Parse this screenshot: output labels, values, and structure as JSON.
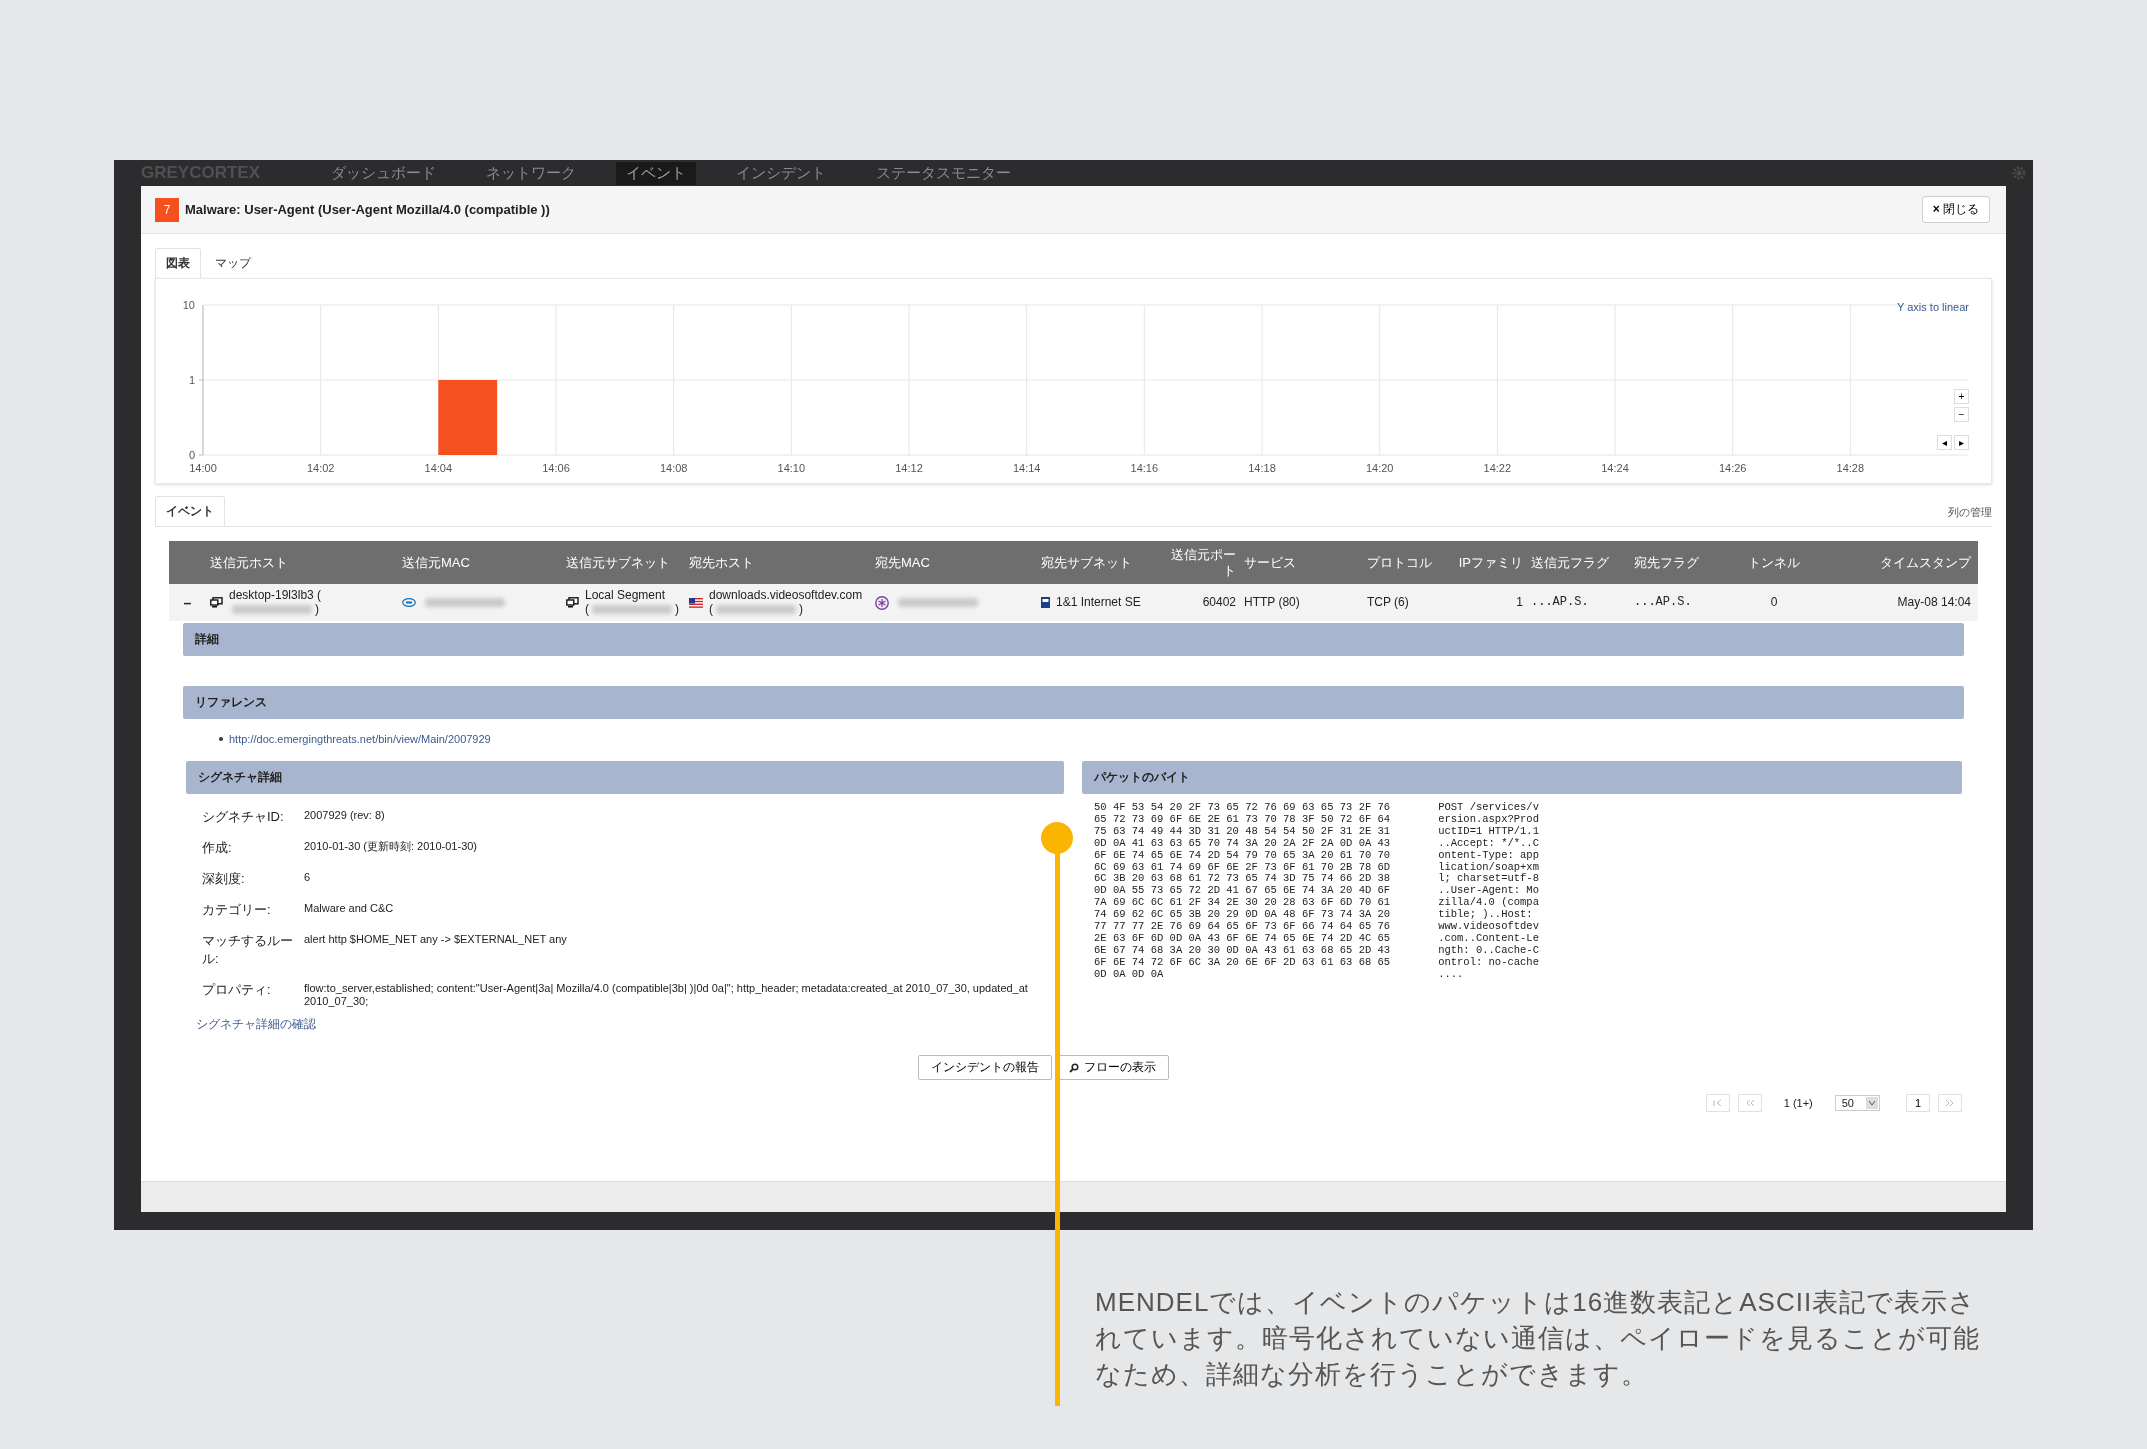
{
  "nav": {
    "brand": "GREYCORTEX",
    "items": [
      {
        "label": "ダッシュボード",
        "selected": false
      },
      {
        "label": "ネットワーク",
        "selected": false
      },
      {
        "label": "イベント",
        "selected": true
      },
      {
        "label": "インシデント",
        "selected": false
      },
      {
        "label": "ステータスモニター",
        "selected": false
      }
    ]
  },
  "modal": {
    "badge": "7",
    "title": "Malware: User-Agent (User-Agent Mozilla/4.0 (compatible ))",
    "close_icon": "×",
    "close": "閉じる"
  },
  "chart_tabs": [
    {
      "label": "図表",
      "selected": true
    },
    {
      "label": "マップ",
      "selected": false
    }
  ],
  "chart": {
    "toggle_link": "Y axis to linear",
    "zoom_in": "+",
    "zoom_out": "−",
    "pan_left": "◂",
    "pan_right": "▸",
    "chart_data": {
      "type": "bar",
      "categories": [
        "14:00",
        "14:02",
        "14:04",
        "14:06",
        "14:08",
        "14:10",
        "14:12",
        "14:14",
        "14:16",
        "14:18",
        "14:20",
        "14:22",
        "14:24",
        "14:26",
        "14:28"
      ],
      "series": [
        {
          "color": "#f4511e",
          "values": [
            0,
            0,
            1,
            0,
            0,
            0,
            0,
            0,
            0,
            0,
            0,
            0,
            0,
            0,
            0
          ]
        }
      ],
      "grid": true,
      "ylim": [
        0,
        2
      ],
      "yticks": [
        0,
        1
      ]
    },
    "y_top_label": "10"
  },
  "events": {
    "tab": {
      "label": "イベント",
      "selected": true
    },
    "manage_columns": "列の管理",
    "columns": [
      "",
      "送信元ホスト",
      "送信元MAC",
      "送信元サブネット",
      "宛先ホスト",
      "宛先MAC",
      "宛先サブネット",
      "送信元ポート",
      "サービス",
      "プロトコル",
      "IPファミリ",
      "送信元フラグ",
      "宛先フラグ",
      "トンネル",
      "タイムスタンプ"
    ],
    "rows": [
      {
        "expanded": true,
        "cells": [
          {
            "kind": "expander",
            "text": "–"
          },
          {
            "kind": "computer",
            "parts": [
              {
                "kind": "text",
                "text": "desktop-19l3lb3 ("
              },
              {
                "kind": "blurred"
              },
              {
                "kind": "text",
                "text": ")"
              }
            ]
          },
          {
            "kind": "nic",
            "parts": [
              {
                "kind": "blurred"
              }
            ]
          },
          {
            "kind": "computer",
            "parts": [
              {
                "kind": "text",
                "text": "Local Segment"
              },
              {
                "kind": "newline"
              },
              {
                "kind": "text",
                "text": "("
              },
              {
                "kind": "blurred"
              },
              {
                "kind": "text",
                "text": ")"
              }
            ]
          },
          {
            "kind": "flag",
            "parts": [
              {
                "kind": "text",
                "text": "downloads.videosoftdev.com"
              },
              {
                "kind": "newline"
              },
              {
                "kind": "text",
                "text": "("
              },
              {
                "kind": "blurred"
              },
              {
                "kind": "text",
                "text": ")"
              }
            ]
          },
          {
            "kind": "vendor",
            "parts": [
              {
                "kind": "blurred"
              }
            ]
          },
          {
            "kind": "network",
            "parts": [
              {
                "kind": "text",
                "text": "1&1 Internet SE"
              }
            ]
          },
          {
            "kind": "plain",
            "parts": [
              {
                "kind": "text",
                "text": "60402"
              }
            ]
          },
          {
            "kind": "plain",
            "parts": [
              {
                "kind": "text",
                "text": "HTTP (80)"
              }
            ]
          },
          {
            "kind": "plain",
            "parts": [
              {
                "kind": "text",
                "text": "TCP (6)"
              }
            ]
          },
          {
            "kind": "plain",
            "parts": [
              {
                "kind": "text",
                "text": "1"
              }
            ]
          },
          {
            "kind": "mono",
            "parts": [
              {
                "kind": "text",
                "text": "...AP.S."
              }
            ]
          },
          {
            "kind": "mono",
            "parts": [
              {
                "kind": "text",
                "text": "...AP.S."
              }
            ]
          },
          {
            "kind": "plain",
            "parts": [
              {
                "kind": "text",
                "text": "0"
              }
            ]
          },
          {
            "kind": "plain",
            "parts": [
              {
                "kind": "text",
                "text": "May-08 14:04"
              }
            ]
          }
        ]
      }
    ]
  },
  "details": {
    "title": "詳細",
    "references_title": "リファレンス",
    "references": [
      "http://doc.emergingthreats.net/bin/view/Main/2007929"
    ],
    "signature": {
      "title": "シグネチャ詳細",
      "rows": [
        {
          "label": "シグネチャID:",
          "value": "2007929 (rev: 8)"
        },
        {
          "label": "作成:",
          "value": "2010-01-30 (更新時刻: 2010-01-30)"
        },
        {
          "label": "深刻度:",
          "value": "6"
        },
        {
          "label": "カテゴリー:",
          "value": "Malware and C&C"
        },
        {
          "label": "マッチするルール:",
          "value": "alert http $HOME_NET any -> $EXTERNAL_NET any"
        },
        {
          "label": "プロパティ:",
          "value": "flow:to_server,established; content:\"User-Agent|3a| Mozilla/4.0 (compatible|3b| )|0d 0a|\"; http_header; metadata:created_at 2010_07_30, updated_at 2010_07_30;"
        }
      ],
      "link": "シグネチャ詳細の確認"
    },
    "packet": {
      "title": "パケットのバイト",
      "hex": [
        "50 4F 53 54 20 2F 73 65 72 76 69 63 65 73 2F 76",
        "65 72 73 69 6F 6E 2E 61 73 70 78 3F 50 72 6F 64",
        "75 63 74 49 44 3D 31 20 48 54 54 50 2F 31 2E 31",
        "0D 0A 41 63 63 65 70 74 3A 20 2A 2F 2A 0D 0A 43",
        "6F 6E 74 65 6E 74 2D 54 79 70 65 3A 20 61 70 70",
        "6C 69 63 61 74 69 6F 6E 2F 73 6F 61 70 2B 78 6D",
        "6C 3B 20 63 68 61 72 73 65 74 3D 75 74 66 2D 38",
        "0D 0A 55 73 65 72 2D 41 67 65 6E 74 3A 20 4D 6F",
        "7A 69 6C 6C 61 2F 34 2E 30 20 28 63 6F 6D 70 61",
        "74 69 62 6C 65 3B 20 29 0D 0A 48 6F 73 74 3A 20",
        "77 77 77 2E 76 69 64 65 6F 73 6F 66 74 64 65 76",
        "2E 63 6F 6D 0D 0A 43 6F 6E 74 65 6E 74 2D 4C 65",
        "6E 67 74 68 3A 20 30 0D 0A 43 61 63 68 65 2D 43",
        "6F 6E 74 72 6F 6C 3A 20 6E 6F 2D 63 61 63 68 65",
        "0D 0A 0D 0A"
      ],
      "ascii": [
        "POST /services/v",
        "ersion.aspx?Prod",
        "uctID=1 HTTP/1.1",
        "..Accept: */*..C",
        "ontent-Type: app",
        "lication/soap+xm",
        "l; charset=utf-8",
        "..User-Agent: Mo",
        "zilla/4.0 (compa",
        "tible; )..Host: ",
        "www.videosoftdev",
        ".com..Content-Le",
        "ngth: 0..Cache-C",
        "ontrol: no-cache",
        "...."
      ]
    }
  },
  "actions": [
    {
      "kind": "plain",
      "label": "インシデントの報告"
    },
    {
      "kind": "search",
      "label": "フローの表示"
    }
  ],
  "pagination": {
    "info": "1 (1+)",
    "page_size": "50",
    "page": "1"
  },
  "annotation": {
    "text": "MENDELでは、イベントのパケットは16進数表記とASCII表記で表示されています。暗号化されていない通信は、ペイロードを見ることが可能なため、詳細な分析を行うことができます。"
  }
}
